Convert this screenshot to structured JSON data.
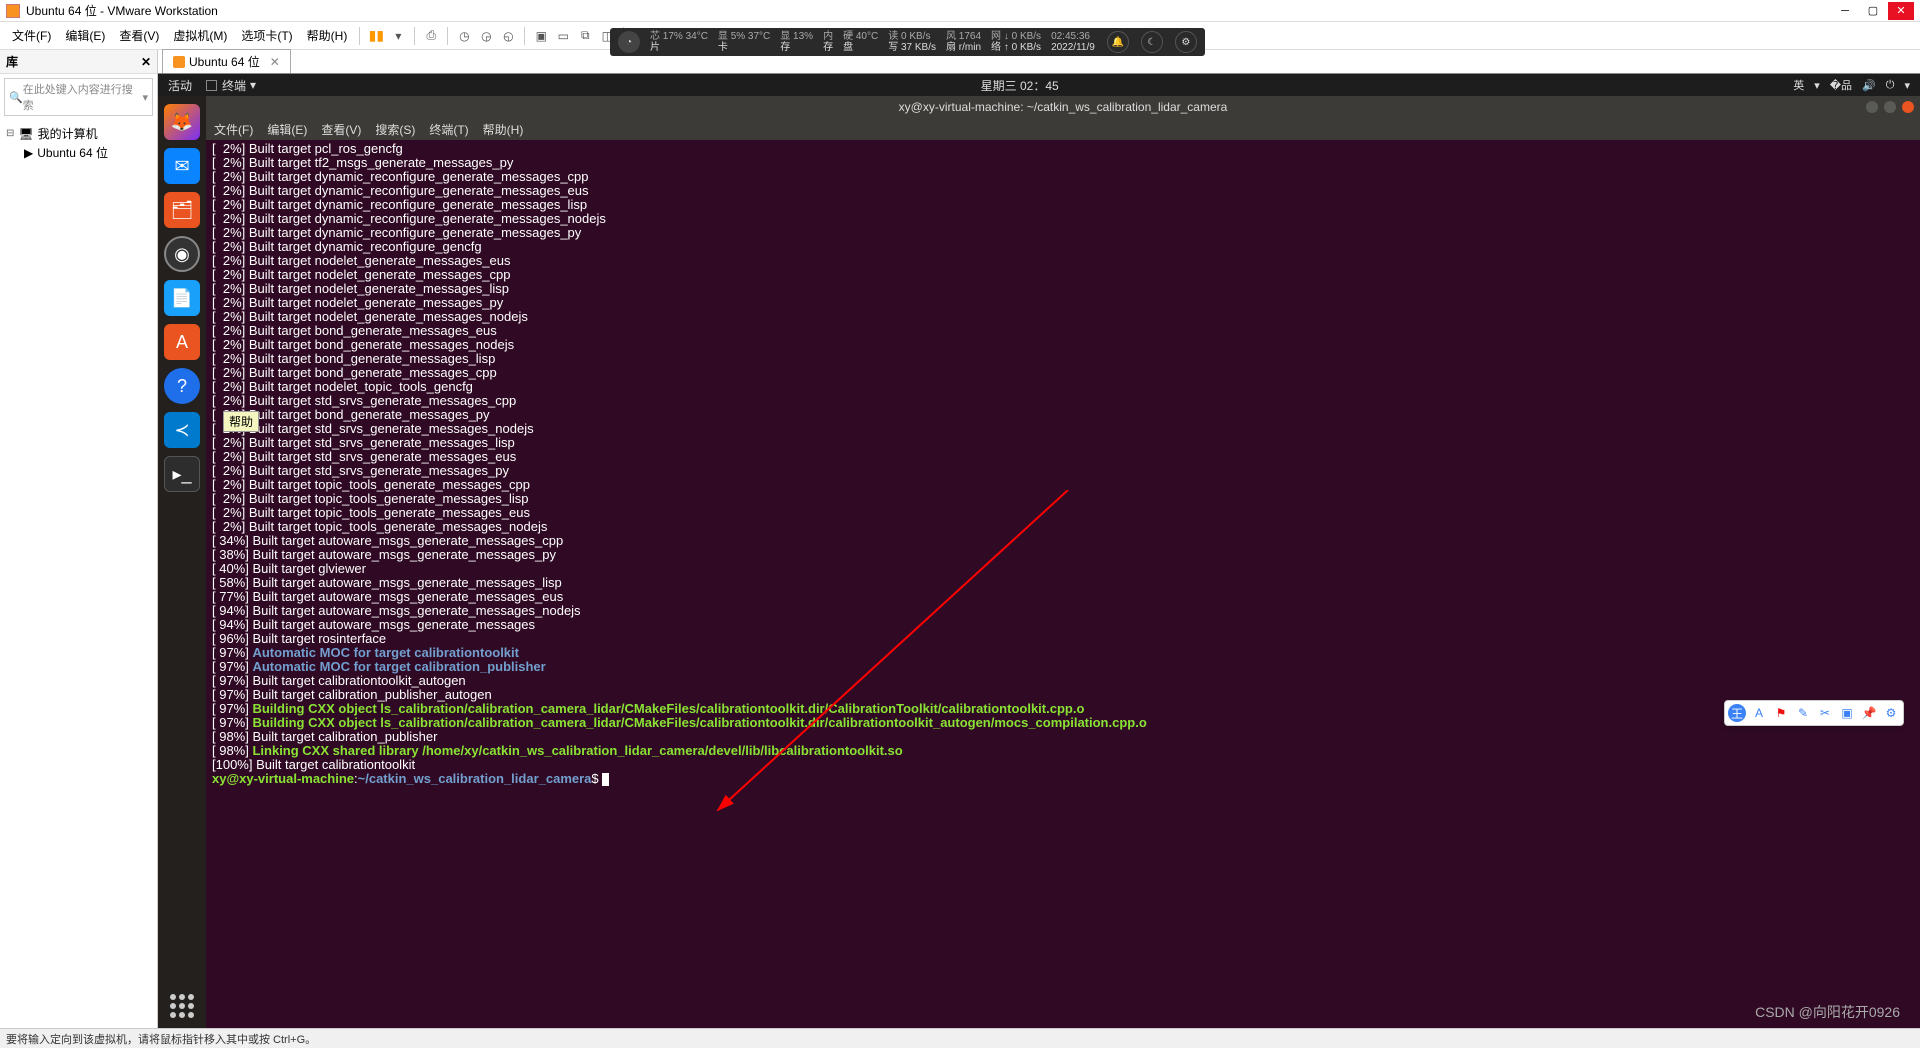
{
  "window": {
    "title": "Ubuntu 64 位 - VMware Workstation"
  },
  "menubar": {
    "items": [
      "文件(F)",
      "编辑(E)",
      "查看(V)",
      "虚拟机(M)",
      "选项卡(T)",
      "帮助(H)"
    ]
  },
  "stats": {
    "chip_l1": "芯 17%  34°C",
    "chip_l2": "片",
    "gpu_l1": "显 5%  37°C",
    "gpu_l2": "卡",
    "mem_l1": "显 13%",
    "mem_l2": "存",
    "ram_l1": "内",
    "ram_l2": "存",
    "disk_l1": "硬 40°C",
    "disk_l2": "盘",
    "io_l1": "读 0 KB/s",
    "io_l2": "写 37 KB/s",
    "fan_l1": "风 1764",
    "fan_l2": "扇 r/min",
    "net_l1": "网 ↓ 0 KB/s",
    "net_l2": "络 ↑ 0 KB/s",
    "time_l1": "02:45:36",
    "time_l2": "2022/11/9"
  },
  "library": {
    "title": "库",
    "search_ph": "在此处键入内容进行搜索",
    "root": "我的计算机",
    "vm": "Ubuntu 64 位"
  },
  "vm_tab": {
    "label": "Ubuntu 64 位"
  },
  "gnome": {
    "activities": "活动",
    "terminal_label": "终端",
    "datetime": "星期三 02：45",
    "lang": "英"
  },
  "term_window": {
    "title": "xy@xy-virtual-machine: ~/catkin_ws_calibration_lidar_camera",
    "menus": [
      "文件(F)",
      "编辑(E)",
      "查看(V)",
      "搜索(S)",
      "终端(T)",
      "帮助(H)"
    ]
  },
  "term_lines": [
    {
      "t": "w",
      "p": "[  2%] ",
      "s": "Built target pcl_ros_gencfg"
    },
    {
      "t": "w",
      "p": "[  2%] ",
      "s": "Built target tf2_msgs_generate_messages_py"
    },
    {
      "t": "w",
      "p": "[  2%] ",
      "s": "Built target dynamic_reconfigure_generate_messages_cpp"
    },
    {
      "t": "w",
      "p": "[  2%] ",
      "s": "Built target dynamic_reconfigure_generate_messages_eus"
    },
    {
      "t": "w",
      "p": "[  2%] ",
      "s": "Built target dynamic_reconfigure_generate_messages_lisp"
    },
    {
      "t": "w",
      "p": "[  2%] ",
      "s": "Built target dynamic_reconfigure_generate_messages_nodejs"
    },
    {
      "t": "w",
      "p": "[  2%] ",
      "s": "Built target dynamic_reconfigure_generate_messages_py"
    },
    {
      "t": "w",
      "p": "[  2%] ",
      "s": "Built target dynamic_reconfigure_gencfg"
    },
    {
      "t": "w",
      "p": "[  2%] ",
      "s": "Built target nodelet_generate_messages_eus"
    },
    {
      "t": "w",
      "p": "[  2%] ",
      "s": "Built target nodelet_generate_messages_cpp"
    },
    {
      "t": "w",
      "p": "[  2%] ",
      "s": "Built target nodelet_generate_messages_lisp"
    },
    {
      "t": "w",
      "p": "[  2%] ",
      "s": "Built target nodelet_generate_messages_py"
    },
    {
      "t": "w",
      "p": "[  2%] ",
      "s": "Built target nodelet_generate_messages_nodejs"
    },
    {
      "t": "w",
      "p": "[  2%] ",
      "s": "Built target bond_generate_messages_eus"
    },
    {
      "t": "w",
      "p": "[  2%] ",
      "s": "Built target bond_generate_messages_nodejs"
    },
    {
      "t": "w",
      "p": "[  2%] ",
      "s": "Built target bond_generate_messages_lisp"
    },
    {
      "t": "w",
      "p": "[  2%] ",
      "s": "Built target bond_generate_messages_cpp"
    },
    {
      "t": "w",
      "p": "[  2%] ",
      "s": "Built target nodelet_topic_tools_gencfg"
    },
    {
      "t": "w",
      "p": "[  2%] ",
      "s": "Built target std_srvs_generate_messages_cpp"
    },
    {
      "t": "w",
      "p": "[  2%] ",
      "s": "Built target bond_generate_messages_py"
    },
    {
      "t": "w",
      "p": "[  2%] ",
      "s": "Built target std_srvs_generate_messages_nodejs"
    },
    {
      "t": "w",
      "p": "[  2%] ",
      "s": "Built target std_srvs_generate_messages_lisp"
    },
    {
      "t": "w",
      "p": "[  2%] ",
      "s": "Built target std_srvs_generate_messages_eus"
    },
    {
      "t": "w",
      "p": "[  2%] ",
      "s": "Built target std_srvs_generate_messages_py"
    },
    {
      "t": "w",
      "p": "[  2%] ",
      "s": "Built target topic_tools_generate_messages_cpp"
    },
    {
      "t": "w",
      "p": "[  2%] ",
      "s": "Built target topic_tools_generate_messages_lisp"
    },
    {
      "t": "w",
      "p": "[  2%] ",
      "s": "Built target topic_tools_generate_messages_eus"
    },
    {
      "t": "w",
      "p": "[  2%] ",
      "s": "Built target topic_tools_generate_messages_nodejs"
    },
    {
      "t": "w",
      "p": "[ 34%] ",
      "s": "Built target autoware_msgs_generate_messages_cpp"
    },
    {
      "t": "w",
      "p": "[ 38%] ",
      "s": "Built target autoware_msgs_generate_messages_py"
    },
    {
      "t": "w",
      "p": "[ 40%] ",
      "s": "Built target glviewer"
    },
    {
      "t": "w",
      "p": "[ 58%] ",
      "s": "Built target autoware_msgs_generate_messages_lisp"
    },
    {
      "t": "w",
      "p": "[ 77%] ",
      "s": "Built target autoware_msgs_generate_messages_eus"
    },
    {
      "t": "w",
      "p": "[ 94%] ",
      "s": "Built target autoware_msgs_generate_messages_nodejs"
    },
    {
      "t": "w",
      "p": "[ 94%] ",
      "s": "Built target autoware_msgs_generate_messages"
    },
    {
      "t": "w",
      "p": "[ 96%] ",
      "s": "Built target rosinterface"
    },
    {
      "t": "b",
      "p": "[ 97%] ",
      "s": "Automatic MOC for target calibrationtoolkit"
    },
    {
      "t": "b",
      "p": "[ 97%] ",
      "s": "Automatic MOC for target calibration_publisher"
    },
    {
      "t": "w",
      "p": "[ 97%] ",
      "s": "Built target calibrationtoolkit_autogen"
    },
    {
      "t": "w",
      "p": "[ 97%] ",
      "s": "Built target calibration_publisher_autogen"
    },
    {
      "t": "g",
      "p": "[ 97%] ",
      "s": "Building CXX object ls_calibration/calibration_camera_lidar/CMakeFiles/calibrationtoolkit.dir/CalibrationToolkit/calibrationtoolkit.cpp.o"
    },
    {
      "t": "g",
      "p": "[ 97%] ",
      "s": "Building CXX object ls_calibration/calibration_camera_lidar/CMakeFiles/calibrationtoolkit.dir/calibrationtoolkit_autogen/mocs_compilation.cpp.o"
    },
    {
      "t": "w",
      "p": "[ 98%] ",
      "s": "Built target calibration_publisher"
    },
    {
      "t": "g",
      "p": "[ 98%] ",
      "s": "Linking CXX shared library /home/xy/catkin_ws_calibration_lidar_camera/devel/lib/libcalibrationtoolkit.so"
    },
    {
      "t": "w",
      "p": "[100%] ",
      "s": "Built target calibrationtoolkit"
    }
  ],
  "prompt": {
    "user": "xy@xy-virtual-machine",
    "path": "~/catkin_ws_calibration_lidar_camera"
  },
  "statusbar": {
    "text": "要将输入定向到该虚拟机，请将鼠标指针移入其中或按 Ctrl+G。"
  },
  "watermark": "CSDN @向阳花开0926",
  "tooltip": "帮助"
}
